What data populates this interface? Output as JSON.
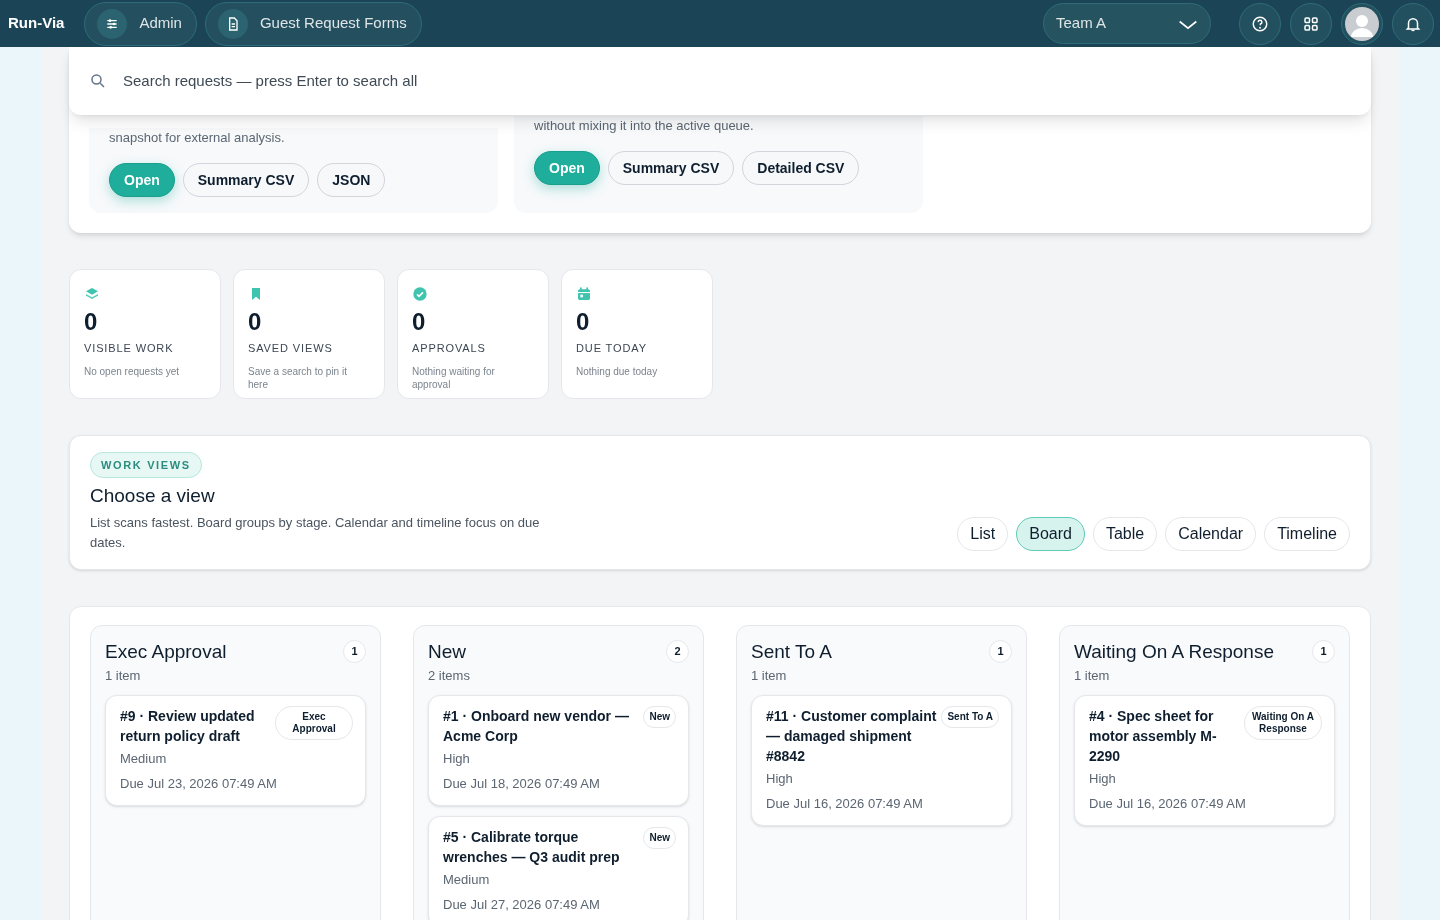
{
  "topbar": {
    "brand": "Run-Via",
    "nav": [
      {
        "label": "Admin"
      },
      {
        "label": "Guest Request Forms"
      }
    ],
    "team_select": {
      "value": "Team A"
    }
  },
  "search": {
    "placeholder": "Search requests — press Enter to search all"
  },
  "export_cards": [
    {
      "text": "snapshot for external analysis.",
      "buttons": [
        {
          "label": "Open",
          "kind": "primary"
        },
        {
          "label": "Summary CSV",
          "kind": "secondary"
        },
        {
          "label": "JSON",
          "kind": "secondary"
        }
      ]
    },
    {
      "text": "without mixing it into the active queue.",
      "buttons": [
        {
          "label": "Open",
          "kind": "primary"
        },
        {
          "label": "Summary CSV",
          "kind": "secondary"
        },
        {
          "label": "Detailed CSV",
          "kind": "secondary"
        }
      ]
    }
  ],
  "stats": [
    {
      "value": "0",
      "label": "VISIBLE WORK",
      "note": "No open requests yet"
    },
    {
      "value": "0",
      "label": "SAVED VIEWS",
      "note": "Save a search to pin it here"
    },
    {
      "value": "0",
      "label": "APPROVALS",
      "note": "Nothing waiting for approval"
    },
    {
      "value": "0",
      "label": "DUE TODAY",
      "note": "Nothing due today"
    }
  ],
  "views": {
    "badge": "WORK VIEWS",
    "title": "Choose a view",
    "description": "List scans fastest. Board groups by stage. Calendar and timeline focus on due dates.",
    "options": [
      {
        "label": "List",
        "selected": false
      },
      {
        "label": "Board",
        "selected": true
      },
      {
        "label": "Table",
        "selected": false
      },
      {
        "label": "Calendar",
        "selected": false
      },
      {
        "label": "Timeline",
        "selected": false
      }
    ]
  },
  "board": [
    {
      "title": "Exec Approval",
      "count": "1",
      "subtitle": "1 item",
      "cards": [
        {
          "title": "#9 · Review updated return policy draft",
          "status": "Exec Approval",
          "priority": "Medium",
          "due": "Due Jul 23, 2026 07:49 AM"
        }
      ]
    },
    {
      "title": "New",
      "count": "2",
      "subtitle": "2 items",
      "cards": [
        {
          "title": "#1 · Onboard new vendor — Acme Corp",
          "status": "New",
          "priority": "High",
          "due": "Due Jul 18, 2026 07:49 AM"
        },
        {
          "title": "#5 · Calibrate torque wrenches — Q3 audit prep",
          "status": "New",
          "priority": "Medium",
          "due": "Due Jul 27, 2026 07:49 AM"
        }
      ]
    },
    {
      "title": "Sent To A",
      "count": "1",
      "subtitle": "1 item",
      "cards": [
        {
          "title": "#11 · Customer complaint — damaged shipment #8842",
          "status": "Sent To A",
          "priority": "High",
          "due": "Due Jul 16, 2026 07:49 AM"
        }
      ]
    },
    {
      "title": "Waiting On A Response",
      "count": "1",
      "subtitle": "1 item",
      "cards": [
        {
          "title": "#4 · Spec sheet for motor assembly M-2290",
          "status": "Waiting On A Response",
          "priority": "High",
          "due": "Due Jul 16, 2026 07:49 AM"
        }
      ]
    }
  ]
}
